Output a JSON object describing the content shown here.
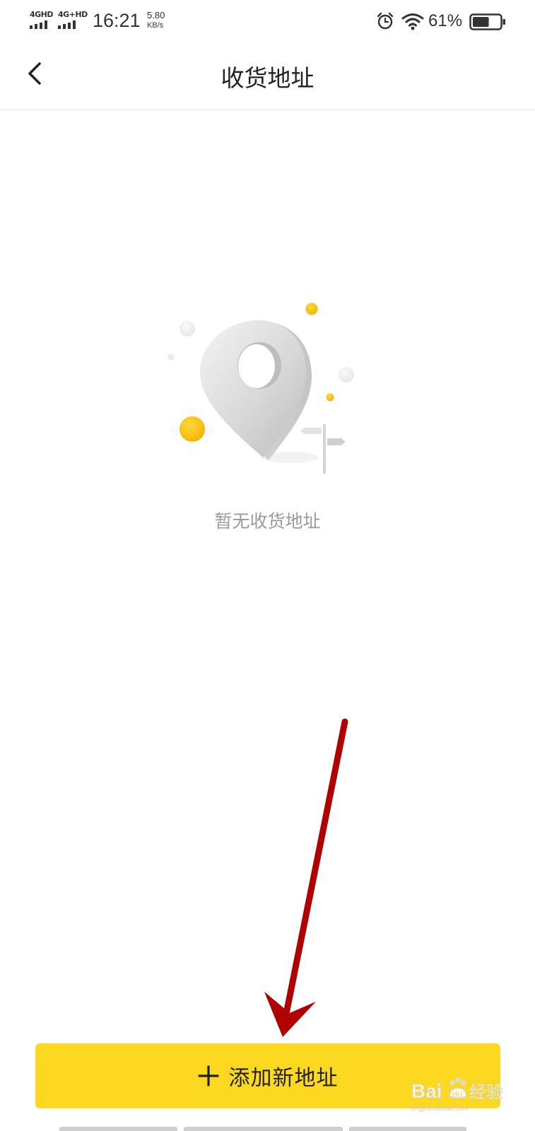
{
  "status_bar": {
    "network1": "4GHD",
    "network2": "4G+HD",
    "time": "16:21",
    "speed_value": "5.80",
    "speed_unit": "KB/s",
    "battery_percent": "61%",
    "battery_level": 0.61,
    "icons": [
      "alarm-icon",
      "wifi-icon",
      "battery-icon"
    ]
  },
  "header": {
    "title": "收货地址",
    "back_icon": "chevron-left-icon"
  },
  "empty_state": {
    "illustration": "location-pin-illustration",
    "message": "暂无收货地址"
  },
  "actions": {
    "add_button_label": "添加新地址",
    "add_button_icon": "plus-icon"
  },
  "watermark": {
    "logo_text": "Baidu经验",
    "sub_text": "jingyan.baidu.com"
  },
  "colors": {
    "accent_yellow": "#fcd820",
    "annotation_red": "#b00000",
    "muted_text": "#9a9a9a"
  }
}
